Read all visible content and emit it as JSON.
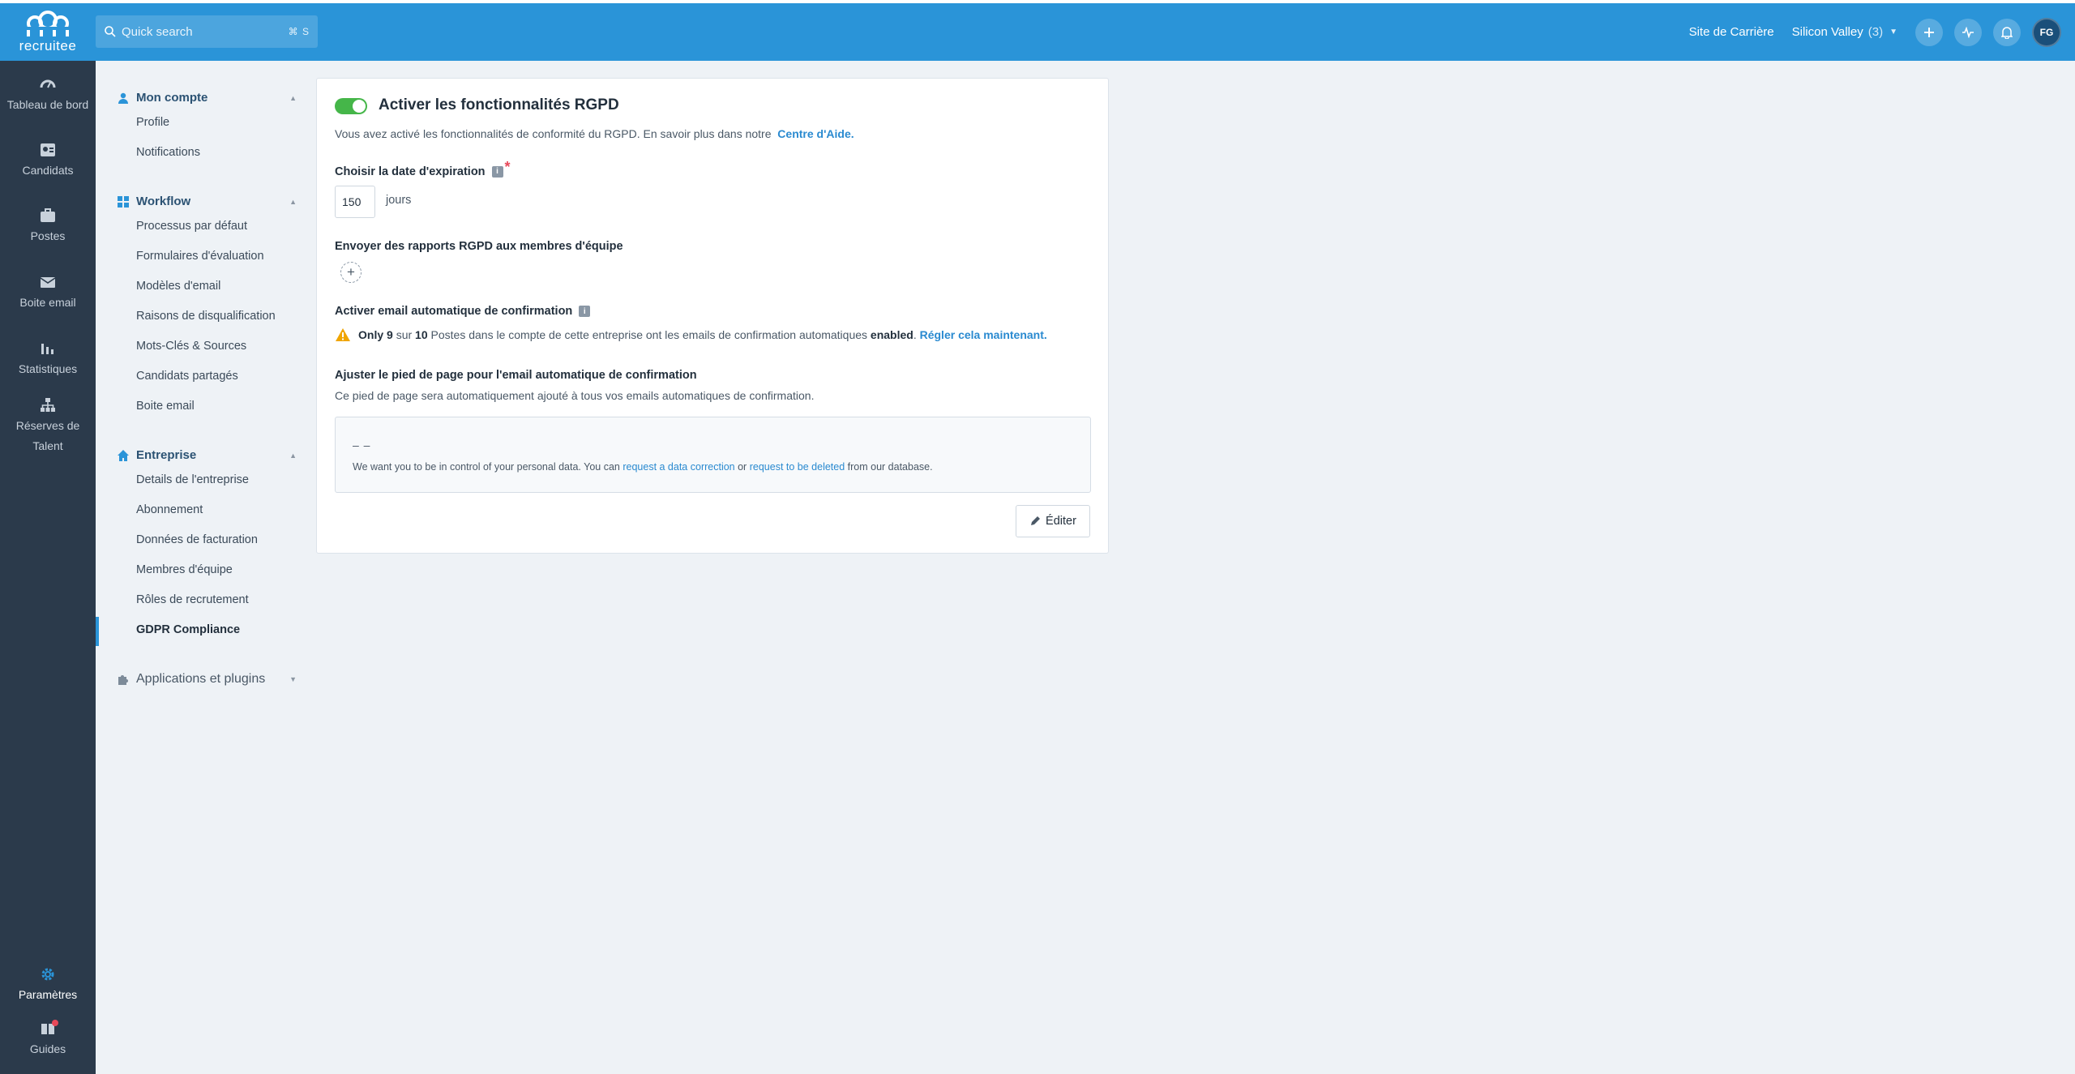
{
  "app": {
    "logo_text": "recruitee"
  },
  "search": {
    "placeholder": "Quick search",
    "shortcut": "⌘ S"
  },
  "header": {
    "career_site": "Site de Carrière",
    "company": "Silicon Valley",
    "company_count": "(3)",
    "avatar_initials": "FG"
  },
  "leftnav": {
    "items": [
      {
        "label": "Tableau de bord",
        "icon": "dashboard-icon"
      },
      {
        "label": "Candidats",
        "icon": "candidates-icon"
      },
      {
        "label": "Postes",
        "icon": "briefcase-icon"
      },
      {
        "label": "Boite email",
        "icon": "mail-icon"
      },
      {
        "label": "Statistiques",
        "icon": "chart-icon"
      },
      {
        "label": "Réserves de Talent",
        "icon": "org-icon"
      }
    ],
    "bottom": [
      {
        "label": "Paramètres",
        "icon": "gear-icon",
        "active": true
      },
      {
        "label": "Guides",
        "icon": "book-icon"
      }
    ]
  },
  "settings_nav": {
    "sections": [
      {
        "title": "Mon compte",
        "items": [
          "Profile",
          "Notifications"
        ]
      },
      {
        "title": "Workflow",
        "items": [
          "Processus par défaut",
          "Formulaires d'évaluation",
          "Modèles d'email",
          "Raisons de disqualification",
          "Mots-Clés & Sources",
          "Candidats partagés",
          "Boite email"
        ]
      },
      {
        "title": "Entreprise",
        "items": [
          "Details de l'entreprise",
          "Abonnement",
          "Données de facturation",
          "Membres d'équipe",
          "Rôles de recrutement",
          "GDPR Compliance"
        ]
      },
      {
        "title": "Applications et plugins",
        "items": []
      }
    ],
    "active_item": "GDPR Compliance"
  },
  "gdpr": {
    "toggle_on": true,
    "title": "Activer les fonctionnalités RGPD",
    "description": "Vous avez activé les fonctionnalités de conformité du RGPD. En savoir plus dans notre",
    "help_link": "Centre d'Aide.",
    "expiry_label": "Choisir la date d'expiration",
    "expiry_value": "150",
    "expiry_unit": "jours",
    "reports_label": "Envoyer des rapports RGPD aux membres d'équipe",
    "auto_email_label": "Activer email automatique de confirmation",
    "warning": {
      "only": "Only",
      "count": "9",
      "sur": "sur",
      "total": "10",
      "text": "Postes dans le compte de cette entreprise ont les emails de confirmation automatiques",
      "state": "enabled",
      "link": "Régler cela maintenant."
    },
    "footer_label": "Ajuster le pied de page pour l'email automatique de confirmation",
    "footer_desc": "Ce pied de page sera automatiquement ajouté à tous vos emails automatiques de confirmation.",
    "footer_box": {
      "dashes": "– –",
      "text_before": "We want you to be in control of your personal data. You can",
      "link1": "request a data correction",
      "or": "or",
      "link2": "request to be deleted",
      "text_after": "from our database."
    },
    "edit_button": "Éditer"
  },
  "colors": {
    "topbar": "#2a94d8",
    "leftnav": "#2b3a4b",
    "accent": "#2a94d8",
    "toggle": "#45b649",
    "warning": "#f0a500"
  }
}
